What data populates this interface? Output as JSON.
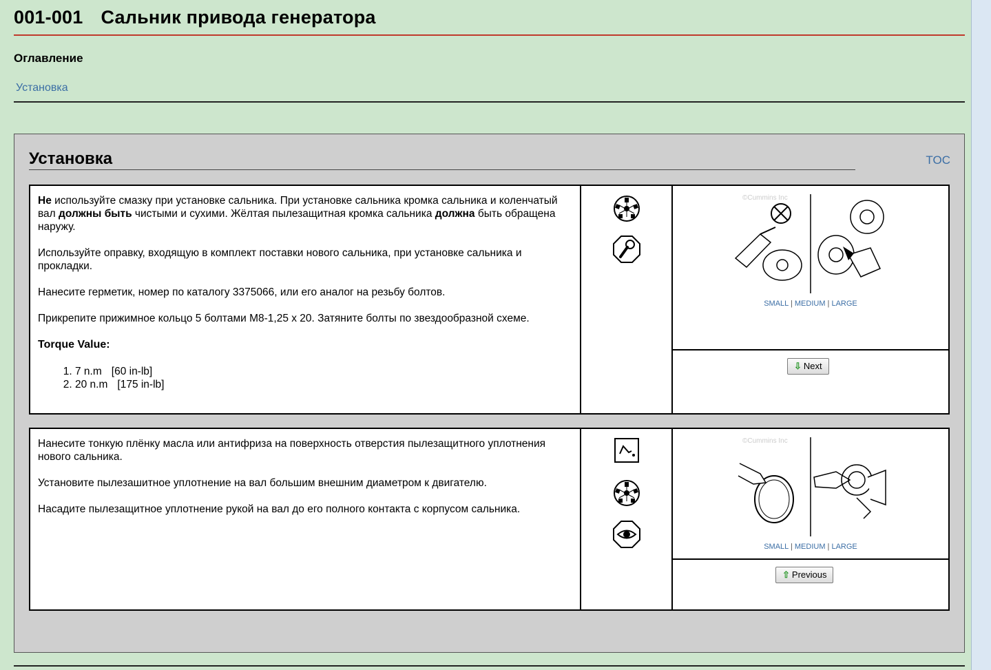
{
  "doc": {
    "code": "001-001",
    "title": "Сальник привода генератора"
  },
  "toc": {
    "heading": "Оглавление",
    "link": "Установка"
  },
  "section": {
    "title": "Установка",
    "toc_link": "TOC"
  },
  "step1": {
    "p1_bold1": "Не",
    "p1_part1": " используйте смазку при установке сальника. При установке сальника кромка сальника и коленчатый вал ",
    "p1_bold2": "должны быть",
    "p1_part2": " чистыми и сухими. Жёлтая пылезащитная кромка сальника ",
    "p1_bold3": "должна",
    "p1_part3": " быть обращена наружу.",
    "p2": "Используйте оправку, входящую в комплект поставки нового сальника, при установке сальника и прокладки.",
    "p3": "Нанесите герметик, номер по каталогу 3375066, или его аналог на резьбу болтов.",
    "p4": "Прикрепите прижимное кольцо 5 болтами M8-1,25 x 20. Затяните болты по звездообразной схеме.",
    "torque_label": "Torque Value:",
    "torque": [
      {
        "value": "7 n.m",
        "unit": "[60 in-lb]"
      },
      {
        "value": "20 n.m",
        "unit": "[175 in-lb]"
      }
    ],
    "icons": [
      "star-pattern-icon",
      "torque-wrench-icon"
    ],
    "image_links": {
      "small": "SMALL",
      "medium": "MEDIUM",
      "large": "LARGE",
      "sep": "|"
    },
    "nav_label": "Next"
  },
  "step2": {
    "p1": "Нанесите тонкую плёнку масла или антифриза на поверхность отверстия пылезащитного уплотнения нового сальника.",
    "p2": "Установите пылезашитное уплотнение на вал большим внешним диаметром к двигателю.",
    "p3": "Насадите пылезащитное уплотнение рукой на вал до его полного контакта с корпусом сальника.",
    "icons": [
      "lubricant-apply-icon",
      "star-pattern-icon",
      "inspect-eye-icon"
    ],
    "image_links": {
      "small": "SMALL",
      "medium": "MEDIUM",
      "large": "LARGE",
      "sep": "|"
    },
    "nav_label": "Previous"
  },
  "watermark": "©Cummins Inc"
}
